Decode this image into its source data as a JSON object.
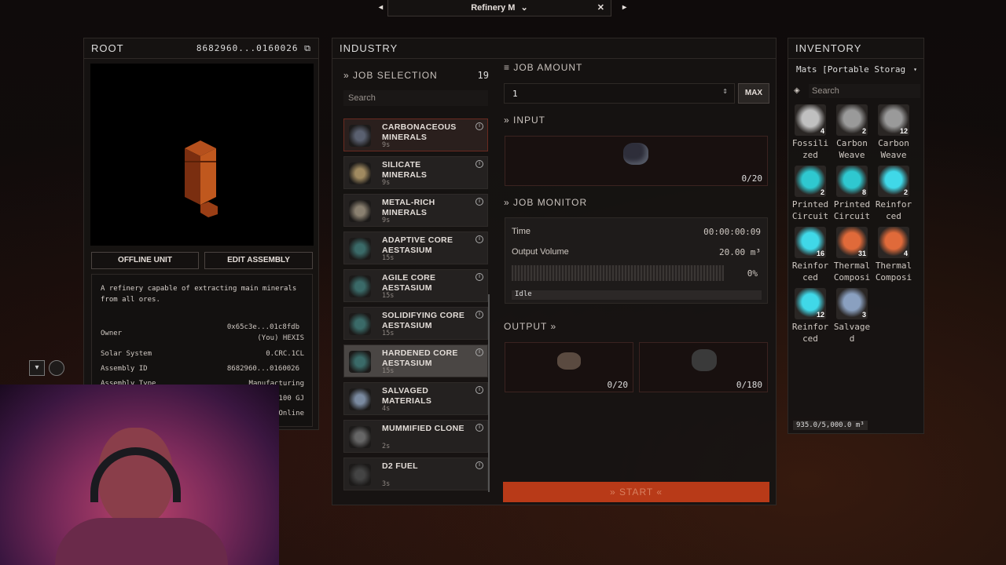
{
  "titlebar": {
    "title": "Refinery M",
    "prev": "◂",
    "next": "▸",
    "close": "✕",
    "chevron": "⌄"
  },
  "root": {
    "title": "ROOT",
    "id": "8682960...0160026",
    "offline_btn": "OFFLINE UNIT",
    "edit_btn": "EDIT ASSEMBLY",
    "description": "A refinery capable of extracting main minerals from all ores.",
    "fields": [
      {
        "label": "Owner",
        "value": "0x65c3e...01c8fdb"
      },
      {
        "label": "",
        "value": "(You) HEXIS"
      },
      {
        "label": "Solar System",
        "value": "0.CRC.1CL"
      },
      {
        "label": "Assembly ID",
        "value": "8682960...0160026"
      },
      {
        "label": "Assembly Type",
        "value": "Manufacturing"
      }
    ],
    "partial_a": "100 GJ",
    "partial_b": "Online"
  },
  "industry": {
    "title": "INDUSTRY",
    "job_selection": "JOB SELECTION",
    "count": "19",
    "search_placeholder": "Search",
    "jobs": [
      {
        "name": "CARBONACEOUS\nMINERALS",
        "time": "9s",
        "color": "#5a6070"
      },
      {
        "name": "SILICATE\nMINERALS",
        "time": "9s",
        "color": "#a08a60"
      },
      {
        "name": "METAL-RICH\nMINERALS",
        "time": "9s",
        "color": "#8a8070"
      },
      {
        "name": "ADAPTIVE CORE\nAESTASIUM",
        "time": "15s",
        "color": "#3a6a68"
      },
      {
        "name": "AGILE CORE\nAESTASIUM",
        "time": "15s",
        "color": "#3a6a68"
      },
      {
        "name": "SOLIDIFYING CORE\nAESTASIUM",
        "time": "15s",
        "color": "#3a6a68"
      },
      {
        "name": "HARDENED CORE\nAESTASIUM",
        "time": "15s",
        "color": "#3a6a68"
      },
      {
        "name": "SALVAGED\nMATERIALS",
        "time": "4s",
        "color": "#7a8aa0"
      },
      {
        "name": "MUMMIFIED CLONE",
        "time": "2s",
        "color": "#666"
      },
      {
        "name": "D2 FUEL",
        "time": "3s",
        "color": "#444"
      }
    ],
    "job_amount": "JOB AMOUNT",
    "amount_value": "1",
    "max": "MAX",
    "input": "INPUT",
    "input_count": "0/20",
    "job_monitor": "JOB MONITOR",
    "time_label": "Time",
    "time_value": "00:00:00:09",
    "volume_label": "Output Volume",
    "volume_value": "20.00 m³",
    "progress_pct": "0%",
    "progress": 0,
    "status": "Idle",
    "output": "OUTPUT",
    "outputs": [
      "0/20",
      "0/180"
    ],
    "start": "» START «"
  },
  "inventory": {
    "title": "INVENTORY",
    "storage": "Mats [Portable Storag",
    "search_placeholder": "Search",
    "capacity": "935.0/5,000.0 m³",
    "items": [
      {
        "name": "Fossili\nzed",
        "qty": "4",
        "color": "#c0c0c0"
      },
      {
        "name": "Carbon\nWeave",
        "qty": "2",
        "color": "#9a9a9a"
      },
      {
        "name": "Carbon\nWeave",
        "qty": "12",
        "color": "#9a9a9a"
      },
      {
        "name": "Printed\nCircuit",
        "qty": "2",
        "color": "#2fc8d0"
      },
      {
        "name": "Printed\nCircuit",
        "qty": "8",
        "color": "#2fc8d0"
      },
      {
        "name": "Reinfor\nced",
        "qty": "2",
        "color": "#40d8e8"
      },
      {
        "name": "Reinfor\nced",
        "qty": "16",
        "color": "#40d8e8"
      },
      {
        "name": "Thermal\nComposi",
        "qty": "31",
        "color": "#e06a3a"
      },
      {
        "name": "Thermal\nComposi",
        "qty": "4",
        "color": "#e06a3a"
      },
      {
        "name": "Reinfor\nced",
        "qty": "12",
        "color": "#40d8e8"
      },
      {
        "name": "Salvage\nd",
        "qty": "3",
        "color": "#8aa0c0"
      }
    ]
  }
}
